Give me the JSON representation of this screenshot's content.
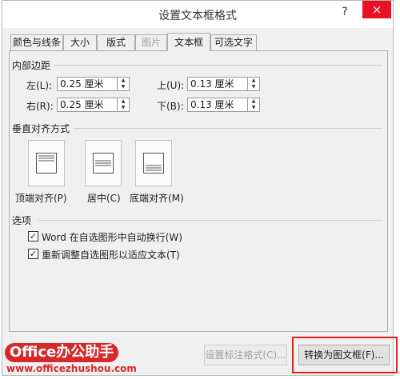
{
  "title": "设置文本框格式",
  "titlebar": {
    "help": "?",
    "close": "×"
  },
  "tabs": [
    {
      "label": "颜色与线条",
      "state": "normal"
    },
    {
      "label": "大小",
      "state": "normal"
    },
    {
      "label": "版式",
      "state": "normal"
    },
    {
      "label": "图片",
      "state": "disabled"
    },
    {
      "label": "文本框",
      "state": "active"
    },
    {
      "label": "可选文字",
      "state": "normal"
    }
  ],
  "margins": {
    "heading": "内部边距",
    "left": {
      "label": "左(L):",
      "value": "0.25 厘米"
    },
    "right": {
      "label": "右(R):",
      "value": "0.25 厘米"
    },
    "top": {
      "label": "上(U):",
      "value": "0.13 厘米"
    },
    "bottom": {
      "label": "下(B):",
      "value": "0.13 厘米"
    }
  },
  "vertical_align": {
    "heading": "垂直对齐方式",
    "options": [
      {
        "label": "顶端对齐(P)",
        "icon": "align-top-icon"
      },
      {
        "label": "居中(C)",
        "icon": "align-middle-icon"
      },
      {
        "label": "底端对齐(M)",
        "icon": "align-bottom-icon"
      }
    ]
  },
  "options": {
    "heading": "选项",
    "word_wrap": {
      "label": "Word 在自选图形中自动换行(W)",
      "checked": true
    },
    "resize": {
      "label": "重新调整自选图形以适应文本(T)",
      "checked": true
    }
  },
  "buttons": {
    "set_default": "设置标注格式(C)...",
    "convert": "转换为图文框(F)..."
  },
  "watermark": {
    "title": "Office办公助手",
    "url": "www.officezhushou.com"
  },
  "colors": {
    "close": "#e81123",
    "highlight": "#e8201c",
    "watermark": "#d7282b"
  }
}
